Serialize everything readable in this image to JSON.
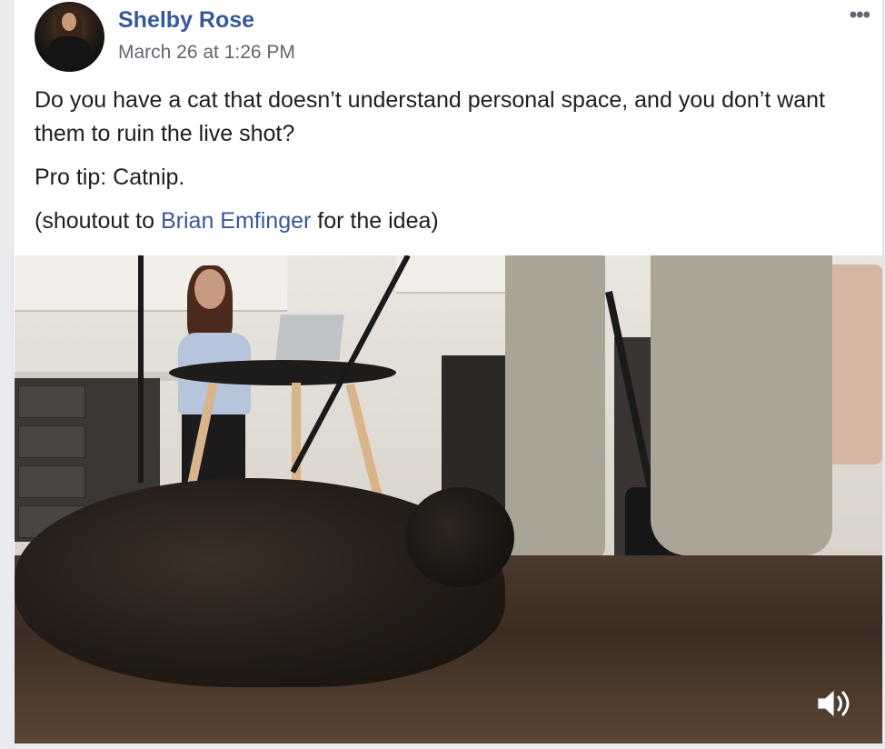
{
  "post": {
    "author": "Shelby Rose",
    "timestamp": "March 26 at 1:26 PM",
    "more_label": "•••",
    "body": {
      "line1": "Do you have a cat that doesn’t understand personal space, and you don’t want them to ruin the live shot?",
      "line2": "Pro tip: Catnip.",
      "line3_prefix": "(shoutout to ",
      "line3_link": "Brian Emfinger",
      "line3_suffix": " for the idea)"
    },
    "video": {
      "sound_icon": "speaker-volume-icon"
    }
  },
  "colors": {
    "link": "#385898",
    "secondary_text": "#616770",
    "body_text": "#1c1e21"
  }
}
